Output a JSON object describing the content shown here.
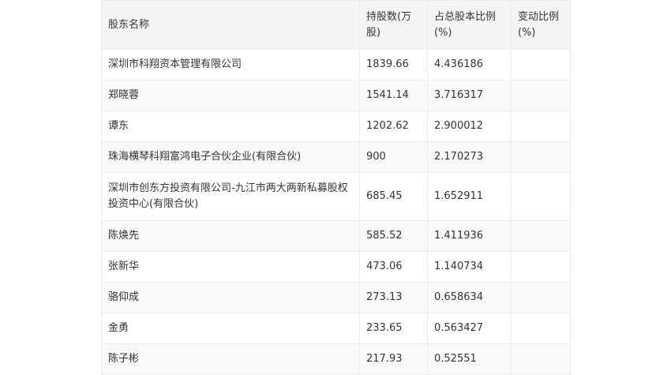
{
  "table": {
    "headers": [
      "股东名称",
      "持股数(万股)",
      "占总股本比例(%)",
      "变动比例(%)"
    ],
    "rows": [
      {
        "name": "深圳市科翔资本管理有限公司",
        "shares": "1839.66",
        "ratio": "4.436186",
        "change": ""
      },
      {
        "name": "郑晓蓉",
        "shares": "1541.14",
        "ratio": "3.716317",
        "change": ""
      },
      {
        "name": "谭东",
        "shares": "1202.62",
        "ratio": "2.900012",
        "change": ""
      },
      {
        "name": "珠海横琴科翔富鸿电子合伙企业(有限合伙)",
        "shares": "900",
        "ratio": "2.170273",
        "change": ""
      },
      {
        "name": "深圳市创东方投资有限公司-九江市两大两新私募股权投资中心(有限合伙)",
        "shares": "685.45",
        "ratio": "1.652911",
        "change": ""
      },
      {
        "name": "陈焕先",
        "shares": "585.52",
        "ratio": "1.411936",
        "change": ""
      },
      {
        "name": "张新华",
        "shares": "473.06",
        "ratio": "1.140734",
        "change": ""
      },
      {
        "name": "骆仰成",
        "shares": "273.13",
        "ratio": "0.658634",
        "change": ""
      },
      {
        "name": "金勇",
        "shares": "233.65",
        "ratio": "0.563427",
        "change": ""
      },
      {
        "name": "陈子彬",
        "shares": "217.93",
        "ratio": "0.52551",
        "change": ""
      }
    ]
  }
}
